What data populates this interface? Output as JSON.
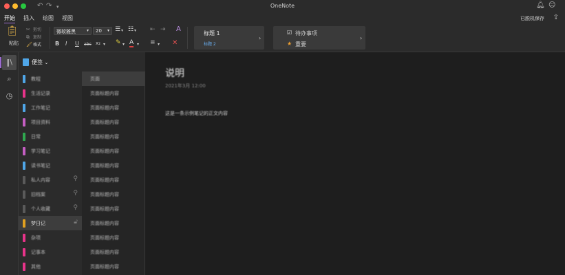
{
  "window": {
    "title": "OneNote"
  },
  "ribbon_tabs": [
    "开始",
    "插入",
    "绘图",
    "视图"
  ],
  "status": {
    "saved": "已脱机保存"
  },
  "ribbon": {
    "paste_label": "粘贴",
    "cut_label": "剪切",
    "copy_label": "复制",
    "format_label": "格式",
    "font_name": "微软雅黑",
    "font_size": "20",
    "bold": "B",
    "italic": "I",
    "underline": "U",
    "strike": "abc",
    "subscript": "x₂",
    "styles": [
      "标题 1",
      "标题 2"
    ],
    "tags": [
      "待办事项",
      "重要"
    ]
  },
  "notebook": {
    "name": "便签"
  },
  "sections": [
    {
      "label": "教程",
      "color": "#4fa6e8"
    },
    {
      "label": "生活记录",
      "color": "#e8338a"
    },
    {
      "label": "工作笔记",
      "color": "#4fa6e8"
    },
    {
      "label": "项目资料",
      "color": "#c45ec2"
    },
    {
      "label": "日常",
      "color": "#2fa84f"
    },
    {
      "label": "学习笔记",
      "color": "#c45ec2"
    },
    {
      "label": "读书笔记",
      "color": "#4fa6e8"
    },
    {
      "label": "私人内容",
      "color": "#5a5a5a"
    },
    {
      "label": "旧档案",
      "color": "#5a5a5a"
    },
    {
      "label": "个人收藏",
      "color": "#5a5a5a"
    },
    {
      "label": "梦日记",
      "color": "#e0a020"
    },
    {
      "label": "杂项",
      "color": "#e8338a"
    },
    {
      "label": "记事本",
      "color": "#e8338a"
    },
    {
      "label": "其他",
      "color": "#e8338a"
    }
  ],
  "pages": [
    "页面",
    "页面标题内容",
    "页面标题内容",
    "页面标题内容",
    "页面标题内容",
    "页面标题内容",
    "页面标题内容",
    "页面标题内容",
    "页面标题内容",
    "页面标题内容",
    "页面标题内容",
    "页面标题内容",
    "页面标题内容",
    "页面标题内容"
  ],
  "note": {
    "title": "说明",
    "date": "2021年3月 12:00",
    "body": "这是一条示例笔记的正文内容"
  }
}
